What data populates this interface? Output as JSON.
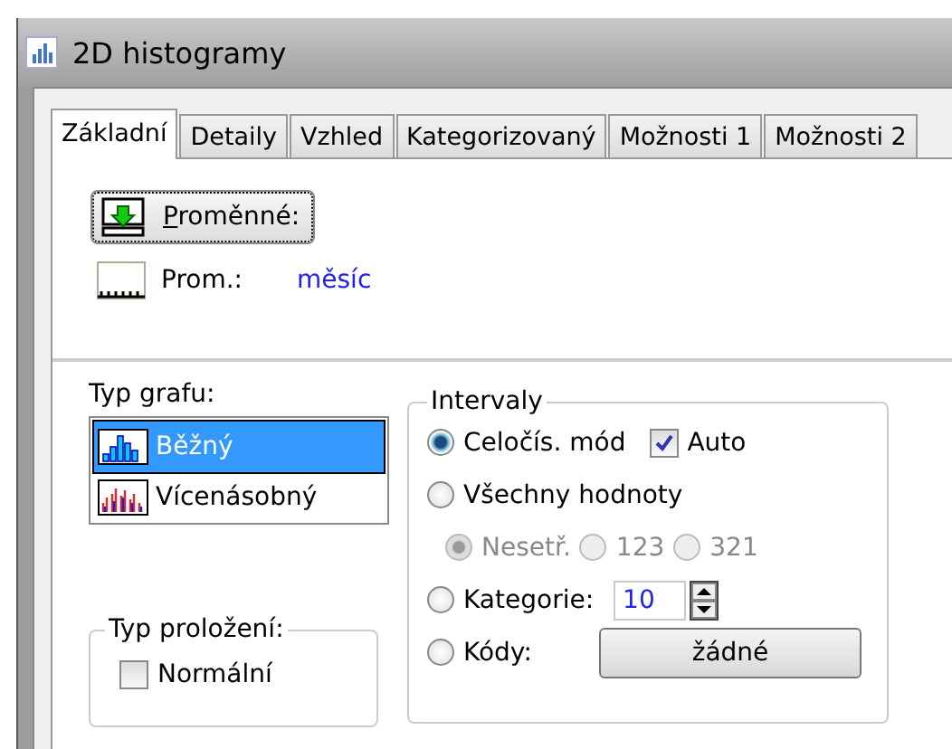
{
  "window": {
    "title": "2D histogramy"
  },
  "tabs": [
    {
      "label": "Základní",
      "selected": true
    },
    {
      "label": "Detaily",
      "selected": false
    },
    {
      "label": "Vzhled",
      "selected": false
    },
    {
      "label": "Kategorizovaný",
      "selected": false
    },
    {
      "label": "Možnosti 1",
      "selected": false
    },
    {
      "label": "Možnosti 2",
      "selected": false
    }
  ],
  "variables_button": {
    "label": "Proměnné:"
  },
  "variable": {
    "label": "Prom.:",
    "value": "měsíc"
  },
  "graph_type": {
    "label": "Typ grafu:",
    "items": [
      {
        "label": "Běžný",
        "selected": true,
        "kind": "single"
      },
      {
        "label": "Vícenásobný",
        "selected": false,
        "kind": "multi"
      }
    ]
  },
  "fit_type": {
    "label": "Typ proložení:",
    "options": [
      {
        "label": "Normální",
        "checked": false
      }
    ]
  },
  "intervals": {
    "label": "Intervaly",
    "integer_mode": {
      "label": "Celočís. mód",
      "selected": true
    },
    "auto": {
      "label": "Auto",
      "checked": true
    },
    "all_values": {
      "label": "Všechny hodnoty",
      "selected": false
    },
    "sort": [
      {
        "label": "Nesetř.",
        "selected": true,
        "disabled": true
      },
      {
        "label": "123",
        "selected": false,
        "disabled": true
      },
      {
        "label": "321",
        "selected": false,
        "disabled": true
      }
    ],
    "categories": {
      "label": "Kategorie:",
      "selected": false,
      "value": "10"
    },
    "codes": {
      "label": "Kódy:",
      "selected": false,
      "button": "žádné"
    }
  }
}
